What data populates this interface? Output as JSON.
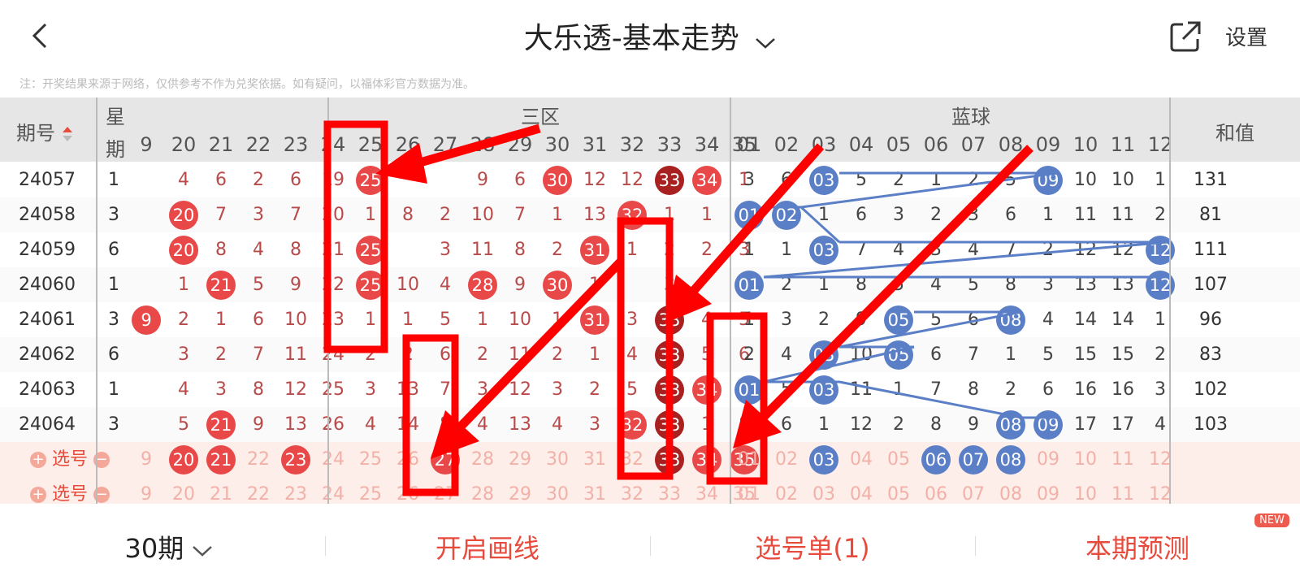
{
  "header": {
    "title": "大乐透-基本走势",
    "settings": "设置"
  },
  "note": "注：开奖结果来源于网络，仅供参考不作为兑奖依据。如有疑问，以福体彩官方数据为准。",
  "table": {
    "col_period": "期号",
    "col_week_1": "星",
    "col_week_2": "期",
    "zone_red": "三区",
    "zone_blue": "蓝球",
    "col_sum": "和值",
    "red_headers": [
      "9",
      "20",
      "21",
      "22",
      "23",
      "24",
      "25",
      "26",
      "27",
      "28",
      "29",
      "30",
      "31",
      "32",
      "33",
      "34",
      "35"
    ],
    "blue_headers": [
      "01",
      "02",
      "03",
      "04",
      "05",
      "06",
      "07",
      "08",
      "09",
      "10",
      "11",
      "12"
    ],
    "rows": [
      {
        "period": "24057",
        "week": "1",
        "red": [
          "",
          "4",
          "6",
          "2",
          "6",
          "19",
          "25",
          "",
          "",
          "9",
          "6",
          "30",
          "12",
          "12",
          "33",
          "34",
          "1"
        ],
        "redhits": [
          6,
          11,
          14,
          15
        ],
        "blue": [
          "3",
          "6",
          "03",
          "5",
          "2",
          "1",
          "2",
          "5",
          "09",
          "10",
          "10",
          "1"
        ],
        "bluehits": [
          2,
          8
        ],
        "sum": "131"
      },
      {
        "period": "24058",
        "week": "3",
        "red": [
          "",
          "20",
          "7",
          "3",
          "7",
          "20",
          "1",
          "8",
          "2",
          "10",
          "7",
          "1",
          "13",
          "32",
          "1",
          "1",
          "2"
        ],
        "redhits": [
          1,
          13
        ],
        "blue": [
          "01",
          "02",
          "1",
          "6",
          "3",
          "2",
          "3",
          "6",
          "1",
          "11",
          "11",
          "2"
        ],
        "bluehits": [
          0,
          1
        ],
        "sum": "81"
      },
      {
        "period": "24059",
        "week": "6",
        "red": [
          "",
          "20",
          "8",
          "4",
          "8",
          "21",
          "25",
          "",
          "3",
          "11",
          "8",
          "2",
          "31",
          "1",
          "2",
          "2",
          "3"
        ],
        "redhits": [
          1,
          6,
          12
        ],
        "blue": [
          "1",
          "1",
          "03",
          "7",
          "4",
          "3",
          "4",
          "7",
          "2",
          "12",
          "12",
          "12"
        ],
        "bluehits": [
          2,
          11
        ],
        "sum": "111"
      },
      {
        "period": "24060",
        "week": "1",
        "red": [
          "",
          "1",
          "21",
          "5",
          "9",
          "22",
          "25",
          "10",
          "4",
          "28",
          "9",
          "30",
          "1",
          "",
          "3",
          "",
          "4"
        ],
        "redhits": [
          2,
          6,
          9,
          11
        ],
        "blue": [
          "01",
          "2",
          "1",
          "8",
          "5",
          "4",
          "5",
          "8",
          "3",
          "13",
          "13",
          "12"
        ],
        "bluehits": [
          0,
          11
        ],
        "sum": "107"
      },
      {
        "period": "24061",
        "week": "3",
        "red": [
          "9",
          "2",
          "1",
          "6",
          "10",
          "23",
          "1",
          "1",
          "5",
          "1",
          "10",
          "1",
          "31",
          "3",
          "33",
          "4",
          "5"
        ],
        "redhits": [
          0,
          12,
          14
        ],
        "blue": [
          "1",
          "3",
          "2",
          "9",
          "05",
          "5",
          "6",
          "08",
          "4",
          "14",
          "14",
          "1"
        ],
        "bluehits": [
          4,
          7
        ],
        "sum": "96"
      },
      {
        "period": "24062",
        "week": "6",
        "red": [
          "",
          "3",
          "2",
          "7",
          "11",
          "24",
          "2",
          "2",
          "6",
          "2",
          "11",
          "2",
          "1",
          "4",
          "33",
          "5",
          "6"
        ],
        "redhits": [
          14
        ],
        "blue": [
          "2",
          "4",
          "03",
          "10",
          "05",
          "6",
          "7",
          "1",
          "5",
          "15",
          "15",
          "2"
        ],
        "bluehits": [
          2,
          4
        ],
        "sum": "83"
      },
      {
        "period": "24063",
        "week": "1",
        "red": [
          "",
          "4",
          "3",
          "8",
          "12",
          "25",
          "3",
          "13",
          "7",
          "3",
          "12",
          "3",
          "2",
          "5",
          "33",
          "34",
          "7"
        ],
        "redhits": [
          14,
          15
        ],
        "blue": [
          "01",
          "5",
          "03",
          "11",
          "1",
          "7",
          "8",
          "2",
          "6",
          "16",
          "16",
          "3"
        ],
        "bluehits": [
          0,
          2
        ],
        "sum": "102"
      },
      {
        "period": "24064",
        "week": "3",
        "red": [
          "",
          "5",
          "21",
          "9",
          "13",
          "26",
          "4",
          "14",
          "8",
          "4",
          "13",
          "4",
          "3",
          "32",
          "33",
          "1",
          "8"
        ],
        "redhits": [
          2,
          13,
          14
        ],
        "blue": [
          "2",
          "6",
          "1",
          "12",
          "2",
          "8",
          "9",
          "08",
          "09",
          "17",
          "17",
          "4"
        ],
        "bluehits": [
          7,
          8
        ],
        "sum": "103"
      }
    ],
    "pick_label": "选号",
    "pick_rows": [
      {
        "red": [
          "9",
          "20",
          "21",
          "22",
          "23",
          "24",
          "25",
          "26",
          "27",
          "28",
          "29",
          "30",
          "31",
          "32",
          "33",
          "34",
          "35"
        ],
        "redhits": [
          1,
          2,
          4,
          8,
          14,
          15,
          16
        ],
        "blue": [
          "01",
          "02",
          "03",
          "04",
          "05",
          "06",
          "07",
          "08",
          "09",
          "10",
          "11",
          "12"
        ],
        "bluehits": [
          2,
          5,
          6,
          7
        ]
      },
      {
        "red": [
          "9",
          "20",
          "21",
          "22",
          "23",
          "24",
          "25",
          "26",
          "27",
          "28",
          "29",
          "30",
          "31",
          "32",
          "33",
          "34",
          "35"
        ],
        "redhits": [],
        "blue": [
          "01",
          "02",
          "03",
          "04",
          "05",
          "06",
          "07",
          "08",
          "09",
          "10",
          "11",
          "12"
        ],
        "bluehits": []
      }
    ]
  },
  "bottom": {
    "periods": "30期",
    "draw_lines": "开启画线",
    "picklist": "选号单(1)",
    "predict": "本期预测",
    "new_badge": "NEW"
  },
  "colors": {
    "red_ball": "#e84848",
    "dark_ball": "#a82020",
    "blue_ball": "#5b7fc7",
    "accent": "#e84a3c"
  }
}
